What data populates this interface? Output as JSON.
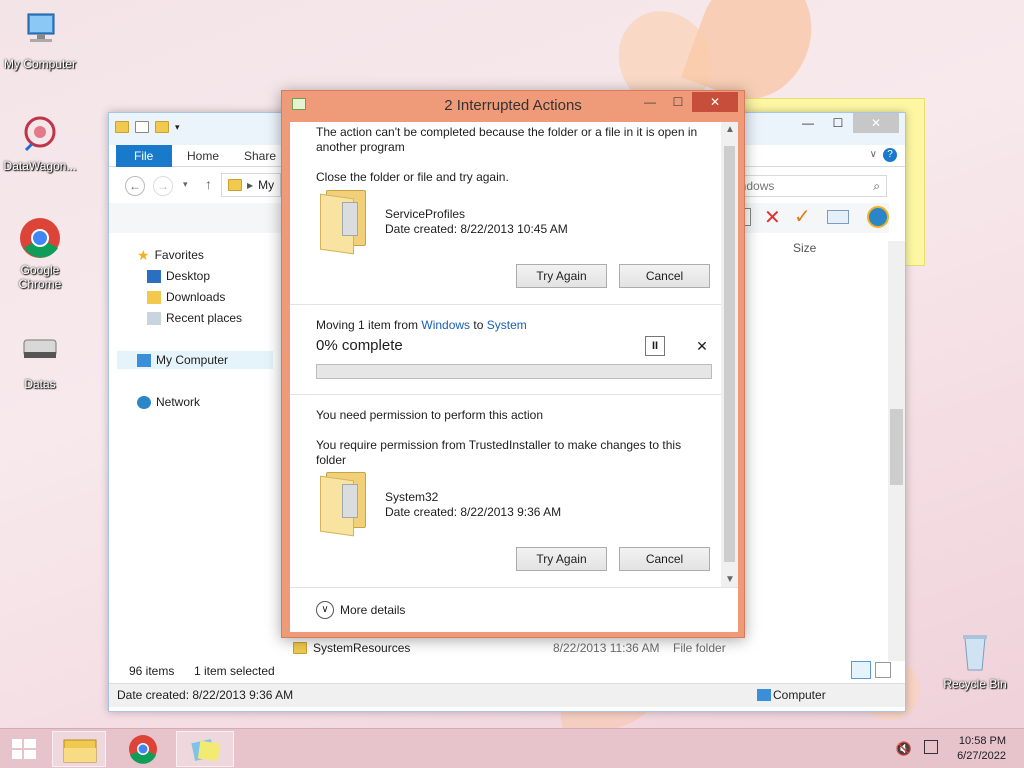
{
  "desktop": {
    "icons": [
      {
        "label": "My Computer"
      },
      {
        "label": "DataWagon..."
      },
      {
        "label": "Google Chrome"
      },
      {
        "label": "Datas"
      },
      {
        "label": "Recycle Bin"
      }
    ]
  },
  "explorer": {
    "ribbon_tabs": [
      "File",
      "Home",
      "Share"
    ],
    "address_partial": "My",
    "search_partial": "indows",
    "column_size": "Size",
    "nav": {
      "favorites": "Favorites",
      "desktop": "Desktop",
      "downloads": "Downloads",
      "recent_places": "Recent places",
      "my_computer": "My Computer",
      "network": "Network"
    },
    "visible_row": {
      "name": "SystemResources",
      "date": "8/22/2013 11:36 AM",
      "type": "File folder"
    },
    "status": {
      "items_count": "96 items",
      "selected": "1 item selected"
    },
    "details_bar": {
      "date_created": "Date created: 8/22/2013 9:36 AM",
      "location": "Computer"
    }
  },
  "dialog": {
    "title": "2 Interrupted Actions",
    "section1": {
      "heading": "The action can't be completed because the folder or a file in it is open in another program",
      "instruction": "Close the folder or file and try again.",
      "item_name": "ServiceProfiles",
      "item_date": "Date created: 8/22/2013 10:45 AM",
      "try_again": "Try Again",
      "cancel": "Cancel"
    },
    "progress": {
      "prefix": "Moving 1 item from",
      "from": "Windows",
      "to_word": "to",
      "to": "System",
      "percent_text": "0% complete",
      "percent": 0,
      "pause_glyph": "II",
      "cancel_glyph": "✕"
    },
    "section2": {
      "heading": "You need permission to perform this action",
      "detail": "You require permission from TrustedInstaller to make changes to this folder",
      "item_name": "System32",
      "item_date": "Date created: 8/22/2013 9:36 AM",
      "try_again": "Try Again",
      "cancel": "Cancel"
    },
    "more_details": "More details"
  },
  "taskbar": {
    "time": "10:58 PM",
    "date": "6/27/2022"
  }
}
